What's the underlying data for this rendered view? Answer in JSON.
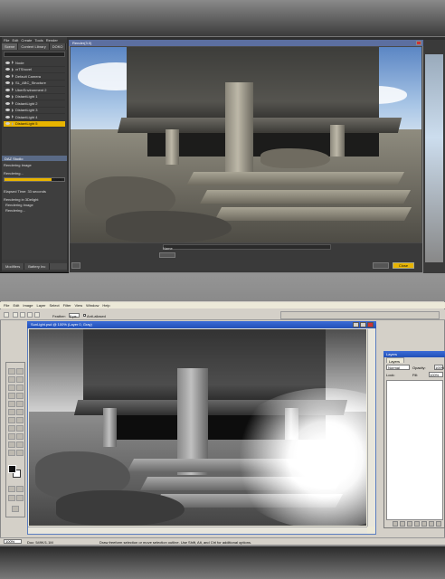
{
  "daz": {
    "menu": [
      "File",
      "Edit",
      "Create",
      "Tools",
      "Render"
    ],
    "tabs": [
      "Scene",
      "Content Library",
      "DOKO"
    ],
    "scene_items": [
      {
        "label": "Node",
        "selected": false
      },
      {
        "label": "vrTShovel",
        "selected": false
      },
      {
        "label": "Default Camera",
        "selected": false
      },
      {
        "label": "SL_ABC_Structure",
        "selected": false
      },
      {
        "label": "UberEnvironment 2",
        "selected": false
      },
      {
        "label": "DistantLight 1",
        "selected": false
      },
      {
        "label": "DistantLight 2",
        "selected": false
      },
      {
        "label": "DistantLight 3",
        "selected": false
      },
      {
        "label": "DistantLight 4",
        "selected": false
      },
      {
        "label": "DistantLight 5",
        "selected": true
      }
    ],
    "progress_title": "DAZ Studio",
    "progress_line1": "Rendering Image",
    "progress_line2": "Rendering...",
    "progress_value": 0.79,
    "progress_label": "79%",
    "elapsed": "Elapsed Time:  33 seconds",
    "log_lines": [
      "Rendering in 3Delight",
      "Rendering Image",
      "Rendering..."
    ],
    "bottom_tabs": [
      "Modifiers",
      "Battery Inc"
    ],
    "render_title": "Render(3.0)",
    "render_name_label": "Name",
    "render_button": "Close"
  },
  "ps": {
    "menu": [
      "File",
      "Edit",
      "Image",
      "Layer",
      "Select",
      "Filter",
      "View",
      "Window",
      "Help"
    ],
    "feather_label": "Feather:",
    "feather_value": "0 px",
    "antialias_label": "Anti-aliased",
    "doc_title": "SunLight.psd @ 100% (Layer 0, Gray)",
    "zoom": "100%",
    "doc_size": "Doc: 549K/1.1M",
    "hint": "Draw freeform selection or move selection outline.  Use Shift, Alt, and Ctrl for additional options.",
    "layers_title": "Layers",
    "layers_tab": "Layers",
    "blend_mode": "Normal",
    "opacity_label": "Opacity:",
    "opacity_value": "100%",
    "lock_label": "Lock:",
    "fill_label": "Fill:",
    "fill_value": "100%"
  },
  "colors": {
    "daz_accent": "#e8b400",
    "ps_title": "#2250b8"
  }
}
